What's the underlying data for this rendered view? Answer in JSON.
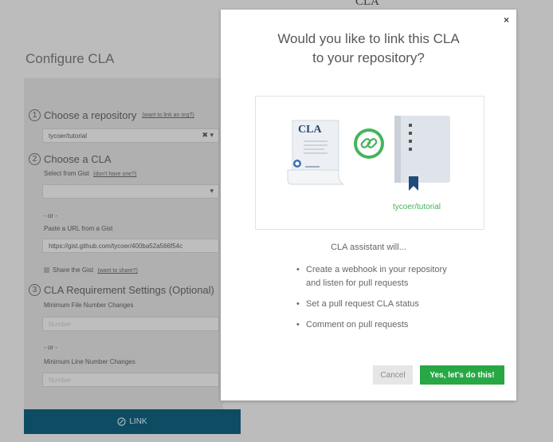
{
  "background": {
    "header_text": "CLA",
    "page_title": "Configure CLA",
    "section1": {
      "number": "1",
      "title": "Choose a repository",
      "link": "(want to link an org?)",
      "selected": "tycoer/tutorial"
    },
    "section2": {
      "number": "2",
      "title": "Choose a CLA",
      "gist_label": "Select from Gist",
      "gist_link": "(don't have one?)",
      "or_text": "- or -",
      "url_label": "Paste a URL from a Gist",
      "url_value": "https://gist.github.com/tycoer/400ba52a566f54c",
      "share_label": "Share the Gist",
      "share_link": "(want to share?)"
    },
    "section3": {
      "number": "3",
      "title": "CLA Requirement Settings (Optional)",
      "file_label": "Minimum File Number Changes",
      "file_placeholder": "Number",
      "or_text": "- or -",
      "line_label": "Minimum Line Number Changes",
      "line_placeholder": "Number"
    },
    "link_button": "LINK"
  },
  "modal": {
    "close": "×",
    "title_line1": "Would you like to link this CLA",
    "title_line2": "to your repository?",
    "document_label": "CLA",
    "repo_name": "tycoer/tutorial",
    "assistant_heading": "CLA assistant will...",
    "bullets": [
      "Create a webhook in your repository",
      "and listen for pull requests",
      "Set a pull request CLA status",
      "Comment on pull requests"
    ],
    "cancel_label": "Cancel",
    "confirm_label": "Yes, let's do this!"
  },
  "colors": {
    "accent_green": "#28a745",
    "link_button_bg": "#0e4c64",
    "chain_green": "#46b45a",
    "bookmark_blue": "#1f4a7a"
  }
}
